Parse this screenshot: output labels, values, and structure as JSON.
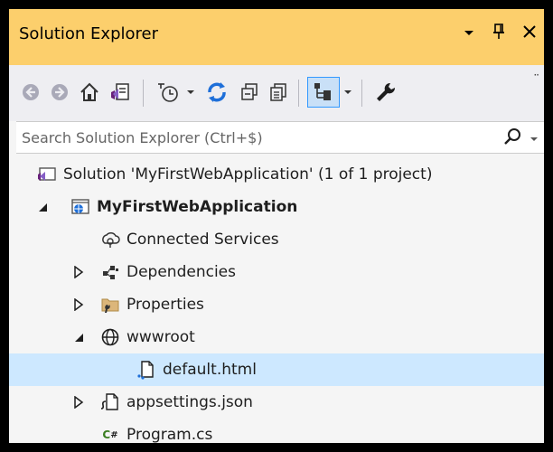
{
  "window": {
    "title": "Solution Explorer",
    "controls": [
      "dropdown-icon",
      "pin-icon",
      "close-icon"
    ]
  },
  "toolbar": {
    "buttons": [
      "back-icon",
      "forward-icon",
      "home-icon",
      "switch-views-icon",
      "pending-changes-filter-icon",
      "sync-icon",
      "collapse-all-icon",
      "show-all-files-icon",
      "preview-selected-icon",
      "properties-icon"
    ],
    "overflow": "··"
  },
  "search": {
    "placeholder": "Search Solution Explorer (Ctrl+$)"
  },
  "tree": {
    "items": [
      {
        "label": "Solution 'MyFirstWebApplication' (1 of 1 project)",
        "icon": "solution-icon",
        "expander": "none",
        "bold": false,
        "selected": false
      },
      {
        "label": "MyFirstWebApplication",
        "icon": "web-project-icon",
        "expander": "expanded",
        "bold": true,
        "selected": false
      },
      {
        "label": "Connected Services",
        "icon": "connected-services-icon",
        "expander": "none",
        "bold": false,
        "selected": false
      },
      {
        "label": "Dependencies",
        "icon": "dependencies-icon",
        "expander": "collapsed",
        "bold": false,
        "selected": false
      },
      {
        "label": "Properties",
        "icon": "properties-folder-icon",
        "expander": "collapsed",
        "bold": false,
        "selected": false
      },
      {
        "label": "wwwroot",
        "icon": "globe-icon",
        "expander": "expanded",
        "bold": false,
        "selected": false
      },
      {
        "label": "default.html",
        "icon": "html-file-icon",
        "expander": "none",
        "bold": false,
        "selected": true
      },
      {
        "label": "appsettings.json",
        "icon": "json-file-icon",
        "expander": "collapsed",
        "bold": false,
        "selected": false
      },
      {
        "label": "Program.cs",
        "icon": "csharp-file-icon",
        "expander": "none",
        "bold": false,
        "selected": false
      }
    ]
  },
  "colors": {
    "titlebar": "#fccf6c",
    "toolbar": "#eeeef2",
    "selection": "#cde8ff",
    "accent_blue": "#1e6fd9"
  }
}
